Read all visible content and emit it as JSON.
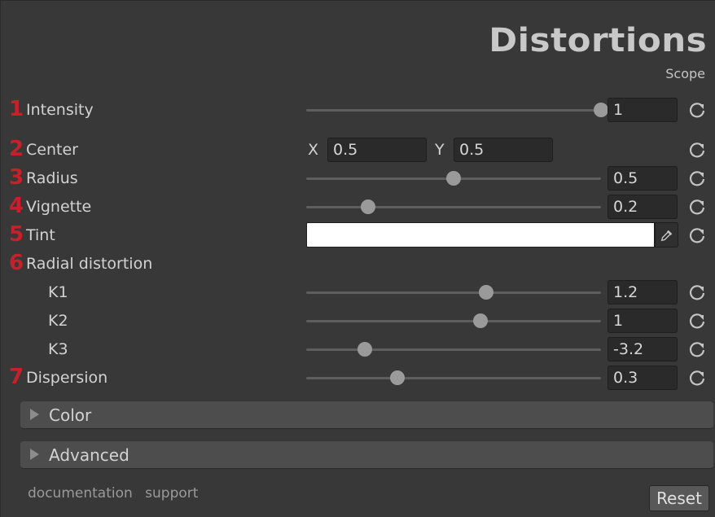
{
  "header": {
    "title": "Distortions",
    "subtitle": "Scope"
  },
  "properties": {
    "intensity": {
      "num": "1",
      "label": "Intensity",
      "value": "1",
      "slider": 1.0
    },
    "center": {
      "num": "2",
      "label": "Center",
      "x_label": "X",
      "x": "0.5",
      "y_label": "Y",
      "y": "0.5"
    },
    "radius": {
      "num": "3",
      "label": "Radius",
      "value": "0.5",
      "slider": 0.5
    },
    "vignette": {
      "num": "4",
      "label": "Vignette",
      "value": "0.2",
      "slider": 0.21
    },
    "tint": {
      "num": "5",
      "label": "Tint",
      "color": "#ffffff"
    },
    "radial": {
      "num": "6",
      "label": "Radial distortion"
    },
    "k1": {
      "label": "K1",
      "value": "1.2",
      "slider": 0.61
    },
    "k2": {
      "label": "K2",
      "value": "1",
      "slider": 0.59
    },
    "k3": {
      "label": "K3",
      "value": "-3.2",
      "slider": 0.2
    },
    "dispersion": {
      "num": "7",
      "label": "Dispersion",
      "value": "0.3",
      "slider": 0.31
    }
  },
  "foldouts": {
    "color": "Color",
    "advanced": "Advanced"
  },
  "footer": {
    "documentation": "documentation",
    "support": "support",
    "reset": "Reset"
  },
  "icons": {
    "reset": "reset-icon",
    "eyedropper": "eyedropper-icon",
    "arrow": "triangle-right-icon"
  },
  "colors": {
    "accent_number": "#c8202a",
    "background": "#383838"
  }
}
